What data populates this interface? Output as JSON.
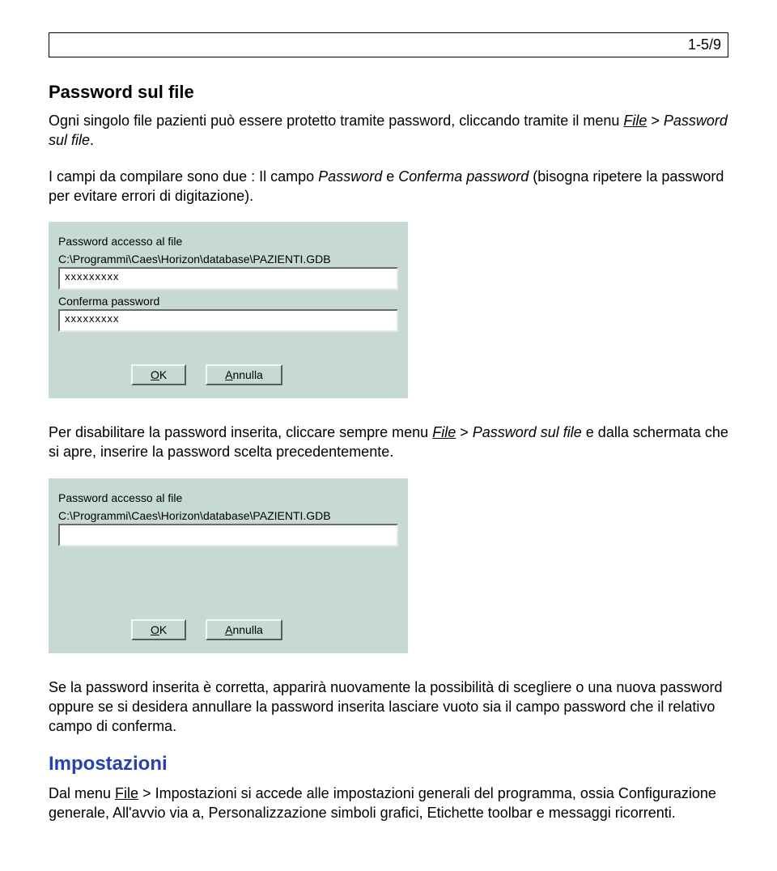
{
  "page_number": "1-5/9",
  "section1": {
    "title": "Password sul file",
    "p1_a": "Ogni singolo file pazienti può essere protetto tramite password, cliccando tramite il menu ",
    "p1_file": "File",
    "p1_b": " > ",
    "p1_menu": "Password sul file",
    "p1_c": ".",
    "p2_a": "I campi da compilare sono due : Il campo ",
    "p2_pw": "Password",
    "p2_b": " e ",
    "p2_conf": "Conferma password",
    "p2_c": " (bisogna ripetere la password per evitare errori di digitazione)."
  },
  "dialog1": {
    "label1": "Password accesso al file",
    "path": "C:\\Programmi\\Caes\\Horizon\\database\\PAZIENTI.GDB",
    "value1": "xxxxxxxxx",
    "label2": "Conferma password",
    "value2": "xxxxxxxxx",
    "ok_u": "O",
    "ok_rest": "K",
    "cancel_u": "A",
    "cancel_rest": "nnulla"
  },
  "section2": {
    "p1_a": "Per disabilitare la password inserita, cliccare sempre menu ",
    "p1_file": "File",
    "p1_b": " > ",
    "p1_menu": "Password sul file",
    "p1_c": " e dalla schermata che si apre, inserire la password scelta precedentemente."
  },
  "dialog2": {
    "label1": "Password accesso al file",
    "path": "C:\\Programmi\\Caes\\Horizon\\database\\PAZIENTI.GDB",
    "value1": "",
    "ok_u": "O",
    "ok_rest": "K",
    "cancel_u": "A",
    "cancel_rest": "nnulla"
  },
  "section3": {
    "p1": "Se la password inserita è corretta, apparirà nuovamente la possibilità di scegliere o una nuova password oppure se si desidera annullare la password inserita lasciare vuoto sia il campo password che il relativo campo di conferma."
  },
  "section4": {
    "title": "Impostazioni",
    "p1_a": "Dal menu ",
    "p1_file": "File",
    "p1_b": " > Impostazioni si accede alle impostazioni generali del programma, ossia Configurazione generale, All'avvio via a, Personalizzazione simboli grafici, Etichette toolbar e messaggi ricorrenti."
  }
}
